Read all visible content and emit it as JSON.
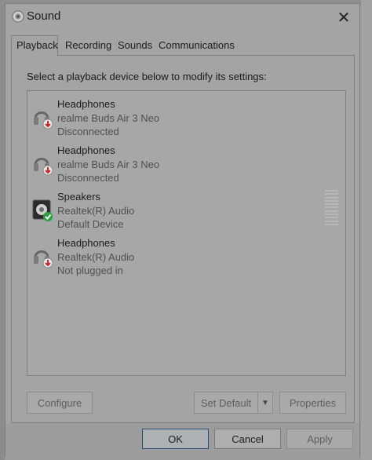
{
  "window": {
    "title": "Sound"
  },
  "tabs": [
    {
      "label": "Playback",
      "active": true
    },
    {
      "label": "Recording",
      "active": false
    },
    {
      "label": "Sounds",
      "active": false
    },
    {
      "label": "Communications",
      "active": false
    }
  ],
  "playback": {
    "instructions": "Select a playback device below to modify its settings:",
    "devices": [
      {
        "name": "Headphones",
        "line2": "realme Buds Air 3 Neo",
        "line3": "Disconnected",
        "icon": "headphones-icon",
        "status_icon": "red-down-arrow-icon"
      },
      {
        "name": "Headphones",
        "line2": "realme Buds Air 3 Neo",
        "line3": "Disconnected",
        "icon": "headphones-icon",
        "status_icon": "red-down-arrow-icon"
      },
      {
        "name": "Speakers",
        "line2": "Realtek(R) Audio",
        "line3": "Default Device",
        "icon": "speaker-icon",
        "status_icon": "green-check-icon"
      },
      {
        "name": "Headphones",
        "line2": "Realtek(R) Audio",
        "line3": "Not plugged in",
        "icon": "headphones-icon",
        "status_icon": "red-down-arrow-icon"
      }
    ],
    "buttons": {
      "configure": "Configure",
      "set_default": "Set Default",
      "properties": "Properties"
    }
  },
  "footer": {
    "ok": "OK",
    "cancel": "Cancel",
    "apply": "Apply"
  },
  "colors": {
    "default_check": "#2e9e3e",
    "disconnected_arrow": "#c62828",
    "ok_focus_border": "#2a4d7a"
  }
}
